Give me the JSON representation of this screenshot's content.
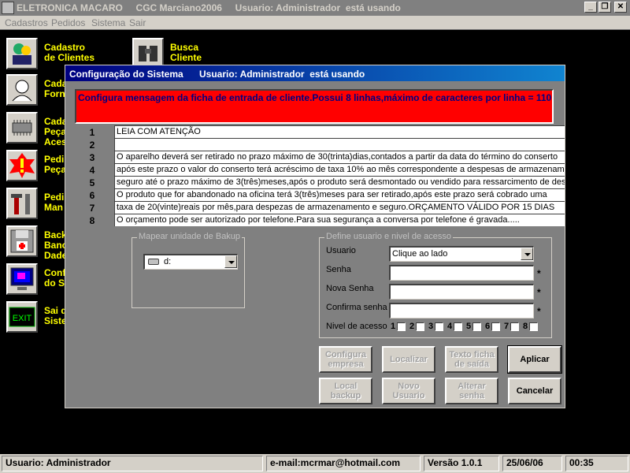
{
  "window": {
    "title": "ELETRONICA MACARO     CGC Marciano2006     Usuario: Administrador  está usando",
    "minimize": "_",
    "restore": "❐",
    "close": "✕"
  },
  "menu": {
    "items": [
      {
        "label": "Cadastros"
      },
      {
        "label": "Pedidos"
      },
      {
        "label": "Sistema"
      },
      {
        "label": "Sair"
      }
    ]
  },
  "launchers": [
    {
      "label": "Cadastro\nde Clientes",
      "icon": "people-icon"
    },
    {
      "label": "Busca\nCliente",
      "icon": "binoculars-icon"
    },
    {
      "label": "Cada\nForn",
      "icon": "phone-person-icon"
    },
    {
      "label": "Cada\nPeça\nAces",
      "icon": "chip-icon"
    },
    {
      "label": "Pedi\nPeça",
      "icon": "alert-icon"
    },
    {
      "label": "Pedi\nMan",
      "icon": "tools-icon"
    },
    {
      "label": "Back\nBanc\nDade",
      "icon": "floppy-icon"
    },
    {
      "label": "Conf\ndo Si",
      "icon": "monitor-icon"
    },
    {
      "label": "Sai d\nSiste",
      "icon": "exit-icon"
    }
  ],
  "dialog": {
    "title": "Configuração do Sistema",
    "user_status": "Usuario: Administrador  está usando",
    "banner": "Configura mensagem da ficha de entrada de cliente.Possui 8 linhas,máximo de caracteres por linha = 110",
    "lines": [
      {
        "num": "1",
        "text": "LEIA COM ATENÇÃO"
      },
      {
        "num": "2",
        "text": ""
      },
      {
        "num": "3",
        "text": "O aparelho deverá ser retirado no prazo máximo de 30(trinta)dias,contados a partir da data do término do conserto"
      },
      {
        "num": "4",
        "text": "após este prazo o valor do conserto terá acréscimo de taxa 10% ao mês correspondente a despesas de armazenamento"
      },
      {
        "num": "5",
        "text": "seguro até o prazo máximo de 3(três)meses,após o produto será desmontado ou vendido para ressarcimento de despesa"
      },
      {
        "num": "6",
        "text": "O produto que for abandonado na oficina terá 3(três)meses para ser retirado,após este prazo será cobrado uma"
      },
      {
        "num": "7",
        "text": "taxa de 20(vinte)reais por mês,para despezas de armazenamento e seguro.ORÇAMENTO VÁLIDO POR 15 DIAS"
      },
      {
        "num": "8",
        "text": "O orçamento pode ser autorizado por telefone.Para sua segurança a conversa por telefone é gravada....."
      }
    ],
    "backup_group": {
      "legend": "Mapear unidade de Bakup",
      "drive_value": "d:"
    },
    "user_group": {
      "legend": "Define usuario e nivel de acesso",
      "usuario_label": "Usuario",
      "usuario_value": "Clique ao lado",
      "senha_label": "Senha",
      "nova_senha_label": "Nova Senha",
      "confirma_label": "Confirma senha",
      "nivel_label": "Nivel de acesso",
      "required_mark": "*",
      "levels": [
        "1",
        "2",
        "3",
        "4",
        "5",
        "6",
        "7",
        "8"
      ]
    },
    "buttons": {
      "configura_empresa": "Configura\nempresa",
      "localizar": "Localizar",
      "texto_ficha": "Texto ficha\nde saída",
      "aplicar": "Aplicar",
      "local_backup": "Local\nbackup",
      "novo_usuario": "Novo\nUsuario",
      "alterar_senha": "Alterar\nsenha",
      "cancelar": "Cancelar"
    }
  },
  "statusbar": {
    "user": "Usuario: Administrador",
    "email": "e-mail:mcrmar@hotmail.com",
    "version": "Versão 1.0.1",
    "date": "25/06/06",
    "time": "00:35"
  }
}
